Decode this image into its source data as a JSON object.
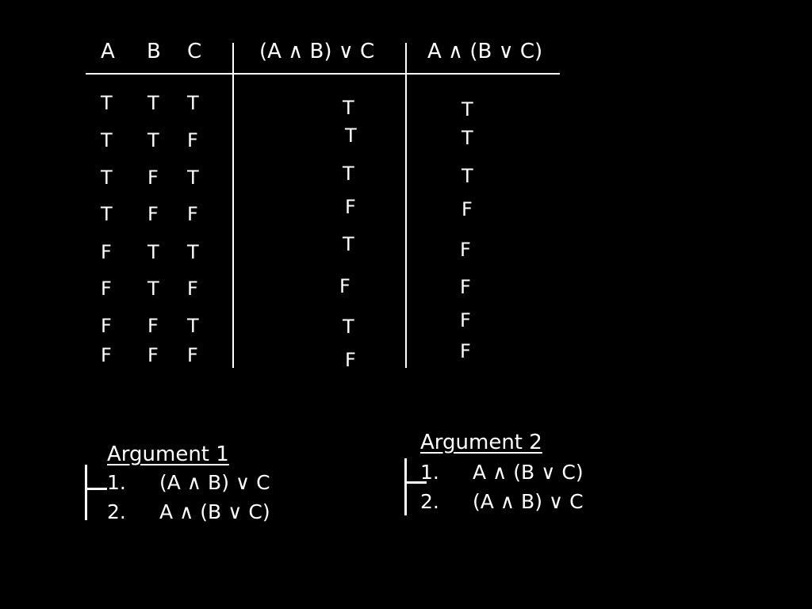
{
  "truth_table": {
    "headers": {
      "a": "A",
      "b": "B",
      "c": "C",
      "expr1": "(A ∧ B) ∨ C",
      "expr2": "A ∧ (B ∨ C)"
    },
    "rows": [
      {
        "a": "T",
        "b": "T",
        "c": "T",
        "expr1": "T",
        "expr2": "T"
      },
      {
        "a": "T",
        "b": "T",
        "c": "F",
        "expr1": "T",
        "expr2": "T"
      },
      {
        "a": "T",
        "b": "F",
        "c": "T",
        "expr1": "T",
        "expr2": "T"
      },
      {
        "a": "T",
        "b": "F",
        "c": "F",
        "expr1": "F",
        "expr2": "F"
      },
      {
        "a": "F",
        "b": "T",
        "c": "T",
        "expr1": "T",
        "expr2": "F"
      },
      {
        "a": "F",
        "b": "T",
        "c": "F",
        "expr1": "F",
        "expr2": "F"
      },
      {
        "a": "F",
        "b": "F",
        "c": "T",
        "expr1": "T",
        "expr2": "F"
      },
      {
        "a": "F",
        "b": "F",
        "c": "F",
        "expr1": "F",
        "expr2": "F"
      }
    ]
  },
  "arguments": [
    {
      "title": "Argument 1",
      "lines": [
        {
          "num": "1.",
          "formula": "(A ∧ B) ∨ C"
        },
        {
          "num": "2.",
          "formula": "A ∧ (B ∨ C)"
        }
      ]
    },
    {
      "title": "Argument 2",
      "lines": [
        {
          "num": "1.",
          "formula": "A ∧ (B ∨ C)"
        },
        {
          "num": "2.",
          "formula": "(A ∧ B) ∨ C"
        }
      ]
    }
  ]
}
